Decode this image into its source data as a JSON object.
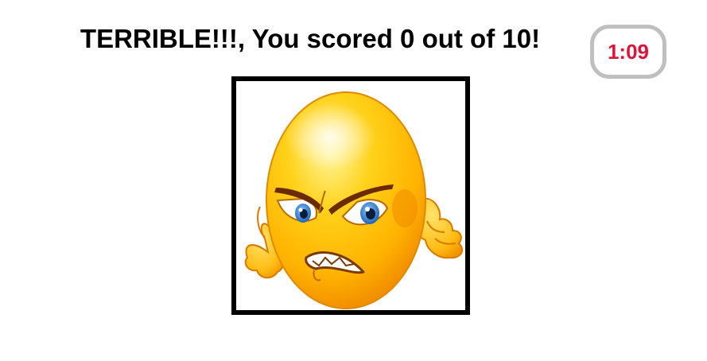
{
  "result": {
    "message": "TERRIBLE!!!, You scored 0 out of 10!"
  },
  "timer": {
    "value": "1:09",
    "color": "#dc143c"
  },
  "result_image": {
    "icon": "angry-emoji-icon"
  }
}
